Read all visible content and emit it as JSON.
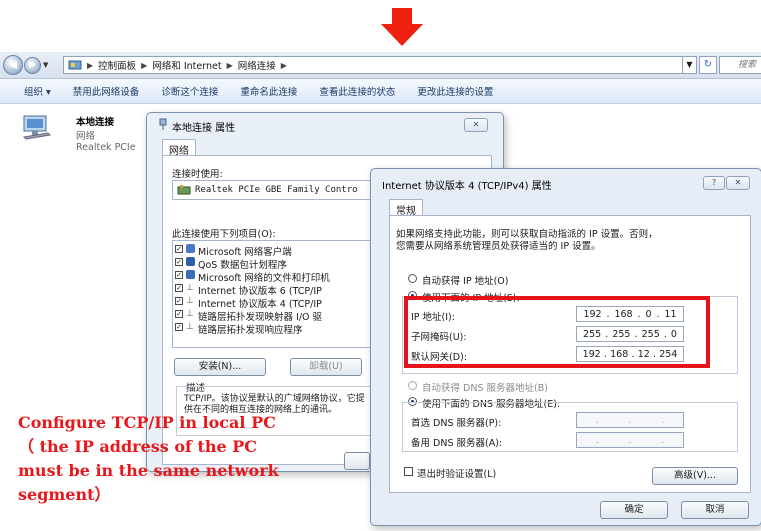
{
  "address_bar": {
    "crumbs": [
      "控制面板",
      "网络和 Internet",
      "网络连接"
    ],
    "search_placeholder": "搜索"
  },
  "command_bar": {
    "items": [
      "组织 ▾",
      "禁用此网络设备",
      "诊断这个连接",
      "重命名此连接",
      "查看此连接的状态",
      "更改此连接的设置"
    ]
  },
  "adapter": {
    "name": "本地连接",
    "type": "网络",
    "device": "Realtek PCIe"
  },
  "properties_dialog": {
    "title": "本地连接 属性",
    "tab": "网络",
    "connect_using_label": "连接时使用:",
    "adapter_name": "Realtek PCIe GBE Family Contro",
    "items_label": "此连接使用下列项目(O):",
    "items": [
      "Microsoft 网络客户端",
      "QoS 数据包计划程序",
      "Microsoft 网络的文件和打印机",
      "Internet 协议版本 6 (TCP/IP",
      "Internet 协议版本 4 (TCP/IP",
      "链路层拓扑发现映射器 I/O 驱",
      "链路层拓扑发现响应程序"
    ],
    "install_button": "安装(N)...",
    "uninstall_button": "卸载(U)",
    "description_label": "描述",
    "description_text": "TCP/IP。该协议是默认的广域网络协议，它提供在不同的相互连接的网络上的通讯。"
  },
  "ipv4_dialog": {
    "title": "Internet 协议版本 4 (TCP/IPv4) 属性",
    "help_button": "?",
    "tab": "常规",
    "intro_line1": "如果网络支持此功能，则可以获取自动指派的 IP 设置。否则，",
    "intro_line2": "您需要从网络系统管理员处获得适当的 IP 设置。",
    "auto_ip_label": "自动获得 IP 地址(O)",
    "manual_ip_label": "使用下面的 IP 地址(S):",
    "ip_address_label": "IP 地址(I):",
    "ip_address": [
      "192",
      "168",
      "0",
      "11"
    ],
    "subnet_label": "子网掩码(U):",
    "subnet": [
      "255",
      "255",
      "255",
      "0"
    ],
    "gateway_label": "默认网关(D):",
    "gateway": [
      "192",
      "168",
      "12",
      "254"
    ],
    "auto_dns_label": "自动获得 DNS 服务器地址(B)",
    "manual_dns_label": "使用下面的 DNS 服务器地址(E):",
    "preferred_dns_label": "首选 DNS 服务器(P):",
    "alternate_dns_label": "备用 DNS 服务器(A):",
    "validate_label": "退出时验证设置(L)",
    "advanced_button": "高级(V)...",
    "ok_button": "确定",
    "cancel_button": "取消"
  },
  "annotation": {
    "caption_lines": [
      "Configure TCP/IP in local PC",
      "（ the IP address of the PC",
      "must be in the same network",
      "segment）"
    ],
    "color": "#e8171b"
  }
}
